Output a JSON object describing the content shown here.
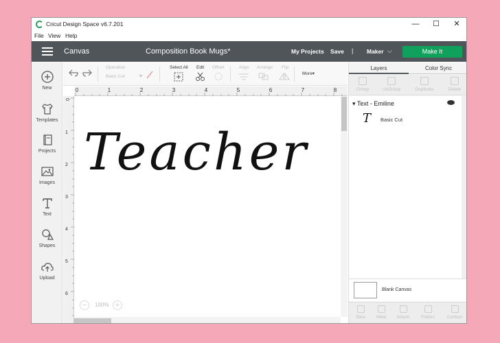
{
  "window": {
    "title": "Cricut Design Space  v6.7.201",
    "controls": {
      "minimize": "—",
      "maximize": "☐",
      "close": "✕"
    }
  },
  "menu": [
    "File",
    "View",
    "Help"
  ],
  "header": {
    "section": "Canvas",
    "project_name": "Composition Book Mugs*",
    "my_projects": "My Projects",
    "save": "Save",
    "separator": "|",
    "machine": "Maker",
    "make_it": "Make It",
    "accent_color": "#10a25c",
    "bar_color": "#4f5559"
  },
  "left_toolbar": [
    {
      "label": "New",
      "icon": "plus-circle-icon"
    },
    {
      "label": "Templates",
      "icon": "shirt-icon"
    },
    {
      "label": "Projects",
      "icon": "book-icon"
    },
    {
      "label": "Images",
      "icon": "image-icon"
    },
    {
      "label": "Text",
      "icon": "text-icon"
    },
    {
      "label": "Shapes",
      "icon": "shapes-icon"
    },
    {
      "label": "Upload",
      "icon": "cloud-upload-icon"
    }
  ],
  "edit_toolbar": {
    "operation_label": "Operation",
    "operation_value": "Basic Cut",
    "select_all": "Select All",
    "edit": "Edit",
    "offset": "Offset",
    "align": "Align",
    "arrange": "Arrange",
    "flip": "Flip",
    "more": "More▾"
  },
  "ruler": {
    "ticks": [
      "0",
      "1",
      "2",
      "3",
      "4",
      "5",
      "6",
      "7",
      "8"
    ],
    "vticks": [
      "0",
      "1",
      "2",
      "3",
      "4",
      "5",
      "6"
    ]
  },
  "canvas": {
    "text": "Teacher"
  },
  "zoom": {
    "value": "100%",
    "minus": "−",
    "plus": "+"
  },
  "layers_panel": {
    "tabs": [
      "Layers",
      "Color Sync"
    ],
    "actions": [
      "Group",
      "UnGroup",
      "Duplicate",
      "Delete"
    ],
    "group_label": "Text - Emiline",
    "item_glyph": "T",
    "item_label": "Basic Cut",
    "blank_canvas": "Blank Canvas",
    "bottom_actions": [
      "Slice",
      "Weld",
      "Attach",
      "Flatten",
      "Contour"
    ]
  }
}
